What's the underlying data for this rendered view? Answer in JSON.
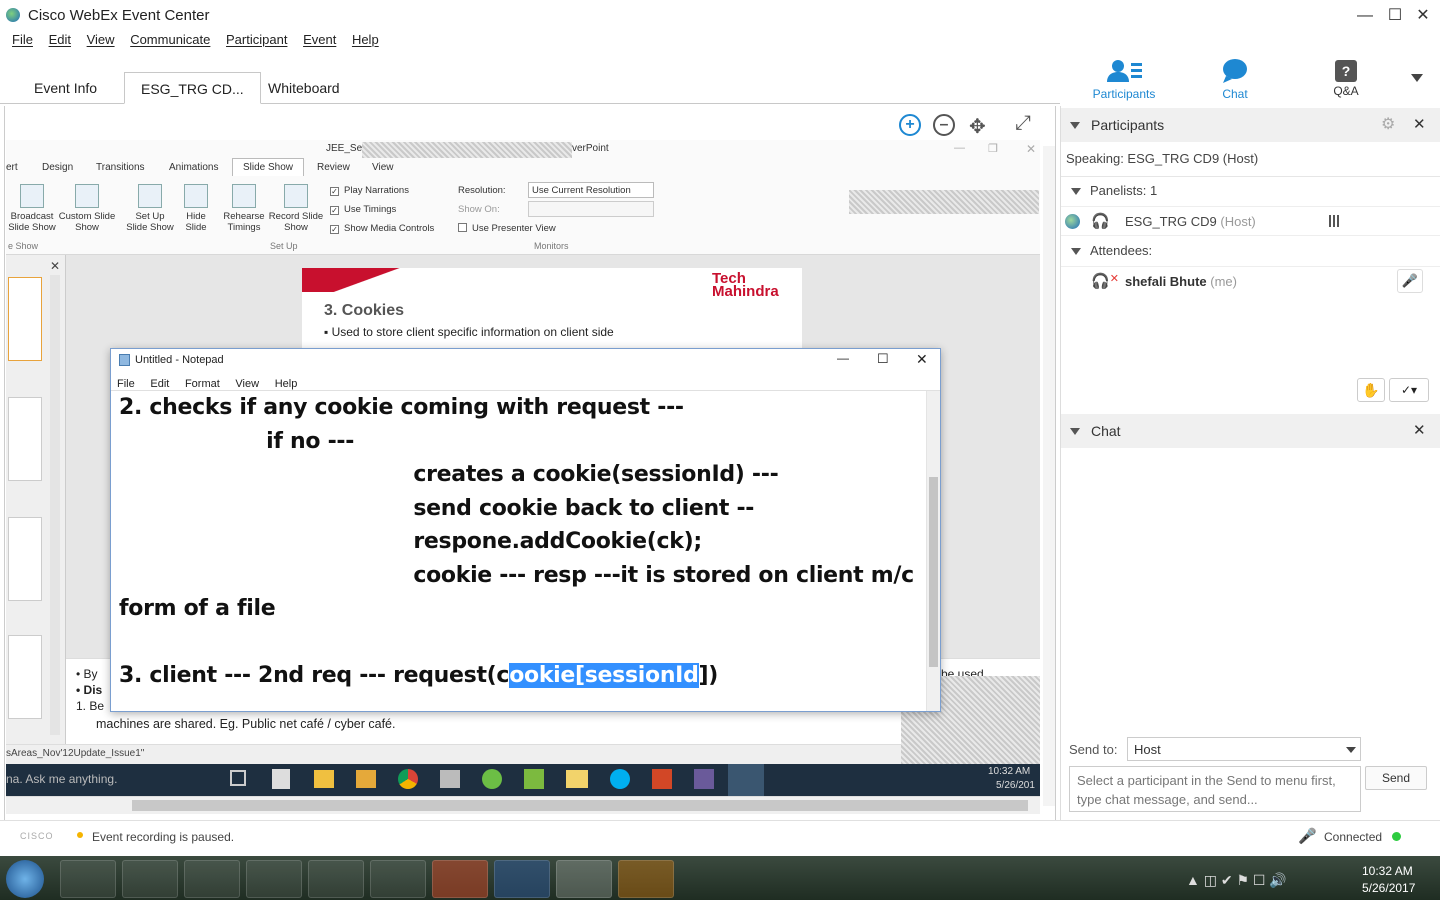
{
  "window": {
    "title": "Cisco WebEx Event Center"
  },
  "menu": [
    "File",
    "Edit",
    "View",
    "Communicate",
    "Participant",
    "Event",
    "Help"
  ],
  "tabs": [
    "Event Info",
    "ESG_TRG CD...",
    "Whiteboard"
  ],
  "top_icons": {
    "participants": "Participants",
    "chat": "Chat",
    "qa": "Q&A"
  },
  "ppt": {
    "window_title_left": "JEE_Serv",
    "window_title_right": "verPoint",
    "ribbon_tabs": [
      "ert",
      "Design",
      "Transitions",
      "Animations",
      "Slide Show",
      "Review",
      "View"
    ],
    "buttons": {
      "broadcast": "Broadcast Slide Show",
      "custom": "Custom Slide Show",
      "setup": "Set Up Slide Show",
      "hide": "Hide Slide",
      "rehearse": "Rehearse Timings",
      "record": "Record Slide Show"
    },
    "checks": {
      "narrations": "Play Narrations",
      "timings": "Use Timings",
      "media": "Show Media Controls"
    },
    "monitors": {
      "resolution_label": "Resolution:",
      "resolution_value": "Use Current Resolution",
      "show_on_label": "Show On:",
      "presenter": "Use Presenter View"
    },
    "groups": {
      "slideshow": "e Show",
      "setup": "Set Up",
      "monitors": "Monitors"
    },
    "slide_heading": "3. Cookies",
    "slide_bullet": "Used to store client specific information on client side",
    "bottom_lines": [
      "By",
      "Dis",
      "Be",
      "machines are shared. Eg. Public net café  / cyber café."
    ],
    "used_text": "be used",
    "status_text": "sAreas_Nov'12Update_Issue1\"",
    "logo": "Tech Mahindra"
  },
  "notepad": {
    "title": "Untitled - Notepad",
    "menu": [
      "File",
      "Edit",
      "Format",
      "View",
      "Help"
    ],
    "lines": [
      "2. checks if any cookie coming with request ---",
      "                    if no ---",
      "                                        creates a cookie(sessionId) ---",
      "                                        send cookie back to client --",
      "                                        respone.addCookie(ck);",
      "                                        cookie --- resp ---it is stored on client m/c in the",
      "form of a file",
      ""
    ],
    "last_line_before": "3. client --- 2nd req --- request(c",
    "last_line_selected": "ookie[sessionId",
    "last_line_after": "])"
  },
  "inner_taskbar": {
    "search": "na. Ask me anything.",
    "time": "10:32 AM",
    "date": "5/26/201"
  },
  "participants_panel": {
    "title": "Participants",
    "speaking": "Speaking: ESG_TRG CD9 (Host)",
    "panelists": "Panelists: 1",
    "panelist_name": "ESG_TRG CD9",
    "panelist_role": "(Host)",
    "attendees": "Attendees:",
    "attendee_name": "shefali Bhute",
    "attendee_role": "(me)"
  },
  "chat_panel": {
    "title": "Chat",
    "send_to_label": "Send to:",
    "send_to_value": "Host",
    "placeholder": "Select a participant in the Send to menu first, type chat message, and send...",
    "send": "Send"
  },
  "status": {
    "recording": "Event recording is paused.",
    "connected": "Connected",
    "brand": "CISCO"
  },
  "system_tray": {
    "time": "10:32 AM",
    "date": "5/26/2017"
  },
  "colors": {
    "accent": "#1e88d2",
    "selection": "#3390ff",
    "connected": "#2ecc40",
    "recording": "#f5b400"
  }
}
